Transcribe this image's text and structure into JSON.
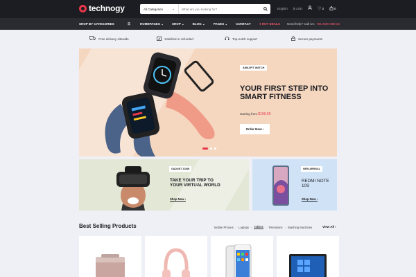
{
  "header": {
    "logo": "technogy",
    "search": {
      "category": "All Categories",
      "placeholder": "What are you looking for?"
    },
    "language": "English",
    "currency": "$ USD",
    "wishlist_count": "3",
    "cart_count": "0"
  },
  "nav": {
    "shop_by_categories": "SHOP BY CATEGORIES",
    "items": [
      "HOMEPAGES",
      "SHOP",
      "BLOG",
      "PAGES",
      "CONTACT"
    ],
    "hot_deals": "HOT DEALS",
    "help_text": "Need help? Call Us:",
    "phone": "+84 2500 888 33"
  },
  "features": [
    "Free delivery sitewide",
    "Satisfied or refunded",
    "Top-notch support",
    "Secure payments"
  ],
  "hero": {
    "badge": "AMAZFIT WATCH",
    "title": "YOUR FIRST STEP INTO SMART FITNESS",
    "price_prefix": "starting from",
    "price": "$199.99",
    "button": "Order Now",
    "colors": {
      "bg": "#f5d6bf",
      "accent": "#e8364a"
    }
  },
  "banner_gadget": {
    "badge": "GADGET ZONE",
    "title": "TAKE YOUR TRIP TO YOUR VIRTUAL WORLD",
    "link": "Shop Now"
  },
  "banner_arrival": {
    "badge": "NEW ARRIVAL",
    "title": "REDMI NOTE 10S",
    "link": "Shop Now"
  },
  "best_selling": {
    "title": "Best Selling Products",
    "tabs": [
      "Mobile Phones",
      "Laptops",
      "Tablets",
      "Televisions",
      "Washing Machines"
    ],
    "active_tab": "Tablets",
    "view_all": "View All"
  }
}
